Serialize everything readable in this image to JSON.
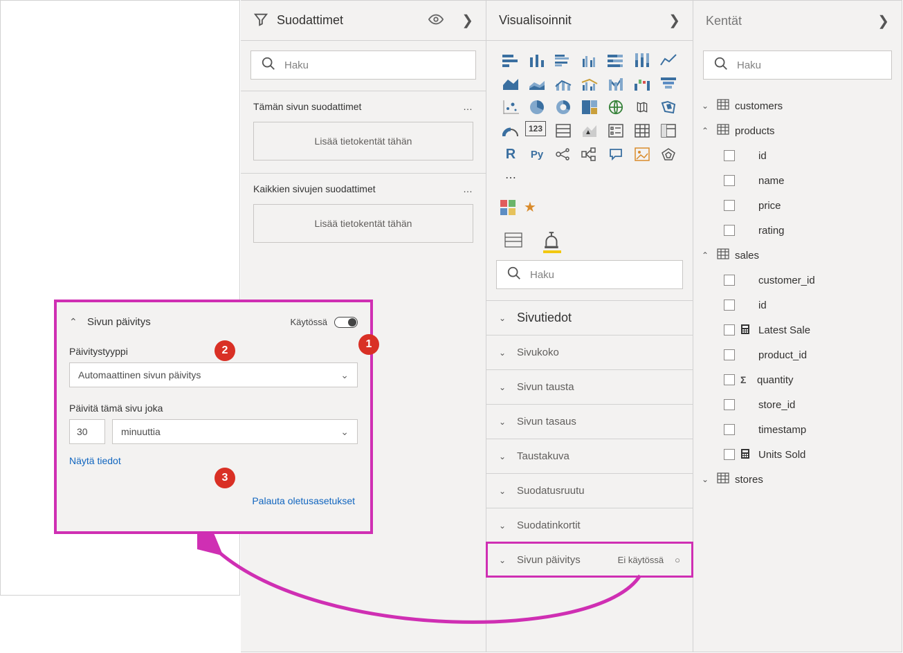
{
  "filters": {
    "title": "Suodattimet",
    "search_placeholder": "Haku",
    "page_filters_title": "Tämän sivun suodattimet",
    "all_pages_filters_title": "Kaikkien sivujen suodattimet",
    "drop_hint": "Lisää tietokentät tähän"
  },
  "visualizations": {
    "title": "Visualisoinnit",
    "search_placeholder": "Haku",
    "sections": {
      "page_info": "Sivutiedot",
      "page_size": "Sivukoko",
      "page_background": "Sivun tausta",
      "page_alignment": "Sivun tasaus",
      "wallpaper": "Taustakuva",
      "filter_pane": "Suodatusruutu",
      "filter_cards": "Suodatinkortit",
      "page_refresh": "Sivun päivitys",
      "page_refresh_state": "Ei käytössä"
    }
  },
  "fields": {
    "title": "Kentät",
    "search_placeholder": "Haku",
    "tables": {
      "customers": "customers",
      "products": "products",
      "sales": "sales",
      "stores": "stores"
    },
    "products_fields": [
      "id",
      "name",
      "price",
      "rating"
    ],
    "sales_fields": [
      "customer_id",
      "id",
      "Latest Sale",
      "product_id",
      "quantity",
      "store_id",
      "timestamp",
      "Units Sold"
    ]
  },
  "callout": {
    "title": "Sivun päivitys",
    "toggle_label": "Käytössä",
    "type_label": "Päivitystyyppi",
    "type_value": "Automaattinen sivun päivitys",
    "interval_label": "Päivitä tämä sivu joka",
    "interval_value": "30",
    "interval_unit": "minuuttia",
    "show_details": "Näytä tiedot",
    "restore_defaults": "Palauta oletusasetukset"
  },
  "badges": {
    "b1": "1",
    "b2": "2",
    "b3": "3"
  }
}
